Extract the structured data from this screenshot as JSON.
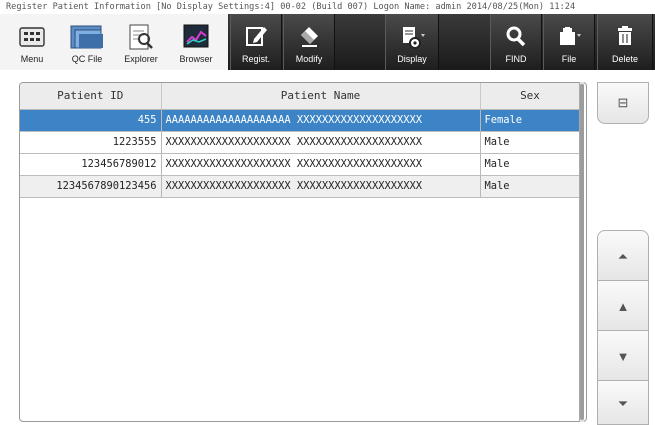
{
  "window": {
    "title": "Register Patient Information [No Display Settings:4] 00-02 (Build 007) Logon Name: admin  2014/08/25(Mon) 11:24"
  },
  "toolbar": {
    "menu_label": "Menu",
    "qcfile_label": "QC File",
    "explorer_label": "Explorer",
    "browser_label": "Browser",
    "regist_label": "Regist.",
    "modify_label": "Modify",
    "display_label": "Display",
    "find_label": "FIND",
    "file_label": "File",
    "delete_label": "Delete"
  },
  "table": {
    "columns": [
      "Patient ID",
      "Patient Name",
      "Sex"
    ],
    "rows": [
      {
        "id": "455",
        "name": "AAAAAAAAAAAAAAAAAAAA XXXXXXXXXXXXXXXXXXXX",
        "sex": "Female",
        "selected": true
      },
      {
        "id": "1223555",
        "name": "XXXXXXXXXXXXXXXXXXXX XXXXXXXXXXXXXXXXXXXX",
        "sex": "Male",
        "selected": false
      },
      {
        "id": "123456789012",
        "name": "XXXXXXXXXXXXXXXXXXXX XXXXXXXXXXXXXXXXXXXX",
        "sex": "Male",
        "selected": false
      },
      {
        "id": "1234567890123456",
        "name": "XXXXXXXXXXXXXXXXXXXX XXXXXXXXXXXXXXXXXXXX",
        "sex": "Male",
        "selected": false
      }
    ]
  },
  "side_buttons": {
    "details": "⊟",
    "first_page": "⏶",
    "prev": "▲",
    "next": "▼",
    "last_page": "⏷"
  },
  "colors": {
    "selection": "#3d84c6",
    "toolbar_dark": "#2a2a2a"
  }
}
